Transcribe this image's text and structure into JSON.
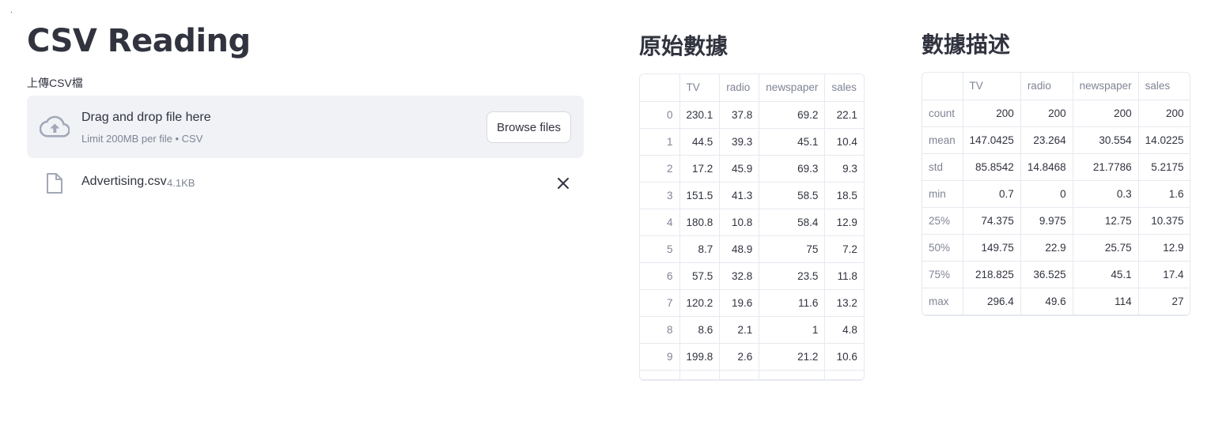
{
  "page": {
    "corner_mark": "."
  },
  "app": {
    "title": "CSV Reading"
  },
  "uploader": {
    "label": "上傳CSV檔",
    "drag_text": "Drag and drop file here",
    "limit_text": "Limit 200MB per file • CSV",
    "browse_label": "Browse files",
    "file": {
      "name": "Advertising.csv",
      "size": "4.1KB"
    }
  },
  "raw_data": {
    "heading": "原始數據",
    "columns": [
      "",
      "TV",
      "radio",
      "newspaper",
      "sales"
    ],
    "rows": [
      [
        "0",
        "230.1",
        "37.8",
        "69.2",
        "22.1"
      ],
      [
        "1",
        "44.5",
        "39.3",
        "45.1",
        "10.4"
      ],
      [
        "2",
        "17.2",
        "45.9",
        "69.3",
        "9.3"
      ],
      [
        "3",
        "151.5",
        "41.3",
        "58.5",
        "18.5"
      ],
      [
        "4",
        "180.8",
        "10.8",
        "58.4",
        "12.9"
      ],
      [
        "5",
        "8.7",
        "48.9",
        "75",
        "7.2"
      ],
      [
        "6",
        "57.5",
        "32.8",
        "23.5",
        "11.8"
      ],
      [
        "7",
        "120.2",
        "19.6",
        "11.6",
        "13.2"
      ],
      [
        "8",
        "8.6",
        "2.1",
        "1",
        "4.8"
      ],
      [
        "9",
        "199.8",
        "2.6",
        "21.2",
        "10.6"
      ]
    ]
  },
  "describe": {
    "heading": "數據描述",
    "columns": [
      "",
      "TV",
      "radio",
      "newspaper",
      "sales"
    ],
    "rows": [
      [
        "count",
        "200",
        "200",
        "200",
        "200"
      ],
      [
        "mean",
        "147.0425",
        "23.264",
        "30.554",
        "14.0225"
      ],
      [
        "std",
        "85.8542",
        "14.8468",
        "21.7786",
        "5.2175"
      ],
      [
        "min",
        "0.7",
        "0",
        "0.3",
        "1.6"
      ],
      [
        "25%",
        "74.375",
        "9.975",
        "12.75",
        "10.375"
      ],
      [
        "50%",
        "149.75",
        "22.9",
        "25.75",
        "12.9"
      ],
      [
        "75%",
        "218.825",
        "36.525",
        "45.1",
        "17.4"
      ],
      [
        "max",
        "296.4",
        "49.6",
        "114",
        "27"
      ]
    ]
  },
  "icons": {
    "upload": "cloud-upload-icon",
    "file": "file-icon",
    "remove": "close-icon"
  },
  "colors": {
    "dropzone_bg": "#f0f2f6",
    "icon_gray": "#a3a8b8",
    "text": "#31333f",
    "muted": "#808495"
  }
}
